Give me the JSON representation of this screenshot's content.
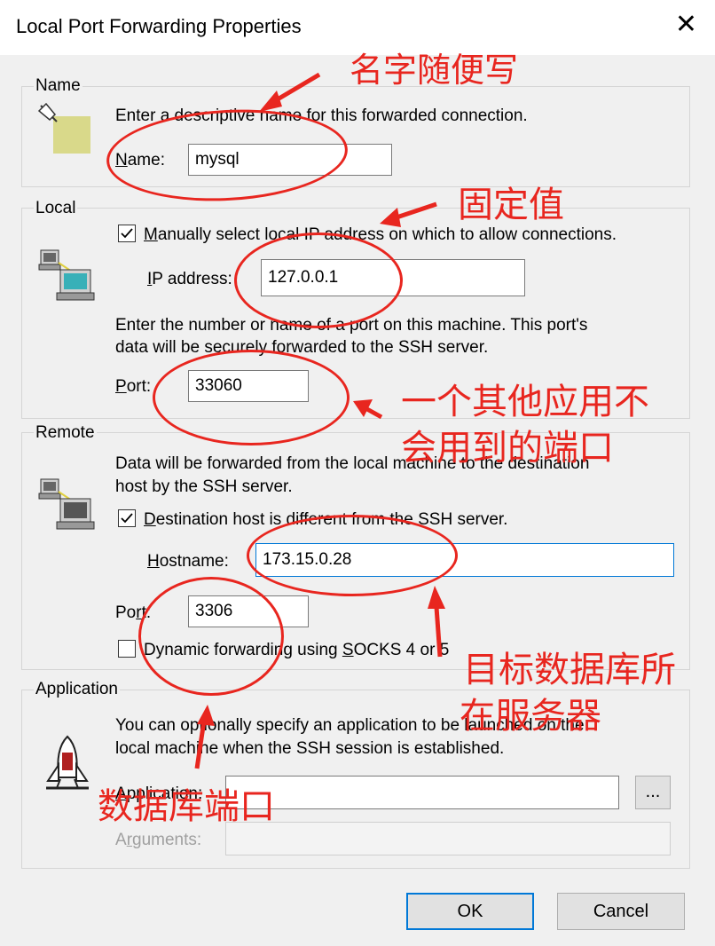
{
  "window": {
    "title": "Local Port Forwarding Properties",
    "close_glyph": "✕"
  },
  "name_group": {
    "legend": "Name",
    "description": "Enter a descriptive name for this forwarded connection.",
    "name_label_u": "N",
    "name_label_rest": "ame:",
    "name_value": "mysql"
  },
  "local_group": {
    "legend": "Local",
    "manual_checkbox_checked": true,
    "manual_label_u": "M",
    "manual_label_rest": "anually select local IP address on which to allow connections.",
    "ip_label_u": "I",
    "ip_label_rest": "P address:",
    "ip_value": "127.0.0.1",
    "port_desc_line1": "Enter the number or name of a port on this machine.  This port's",
    "port_desc_line2": "data will be securely forwarded to the SSH server.",
    "port_label_u": "P",
    "port_label_rest": "ort:",
    "port_value": "33060"
  },
  "remote_group": {
    "legend": "Remote",
    "desc_line1": "Data will be forwarded from the local machine to the destination",
    "desc_line2": "host by the SSH server.",
    "dest_checkbox_checked": true,
    "dest_label_u": "D",
    "dest_label_rest": "estination host is different from the SSH server.",
    "hostname_label_u": "H",
    "hostname_label_rest": "ostname:",
    "hostname_value": "173.15.0.28",
    "port_label_pre": "Po",
    "port_label_u": "r",
    "port_label_rest": "t:",
    "port_value": "3306",
    "dynamic_checkbox_checked": false,
    "dynamic_label_pre": "Dynamic forwarding using ",
    "dynamic_label_u": "S",
    "dynamic_label_rest": "OCKS 4 or 5"
  },
  "application_group": {
    "legend": "Application",
    "desc_line1": "You can optionally specify an application to be launched on the",
    "desc_line2": "local machine when the SSH session is established.",
    "application_label_u": "A",
    "application_label_rest": "pplication:",
    "application_value": "",
    "browse_label": "...",
    "arguments_label_pre": "A",
    "arguments_label_u": "r",
    "arguments_label_rest": "guments:",
    "arguments_value": ""
  },
  "buttons": {
    "ok": "OK",
    "cancel": "Cancel"
  },
  "annotations": {
    "name_note": "名字随便写",
    "ip_note": "固定值",
    "port_note_line1": "一个其他应用不",
    "port_note_line2": "会用到的端口",
    "host_note_line1": "目标数据库所",
    "host_note_line2": "在服务器",
    "db_port_note": "数据库端口"
  },
  "colors": {
    "annotation": "#e8261f",
    "focus": "#0078d7",
    "dialog_bg": "#f0f0f0"
  },
  "icons": [
    "name-tag-icon",
    "computer-network-icon",
    "remote-computer-icon",
    "rocket-launch-icon",
    "checkmark-icon",
    "close-icon"
  ]
}
